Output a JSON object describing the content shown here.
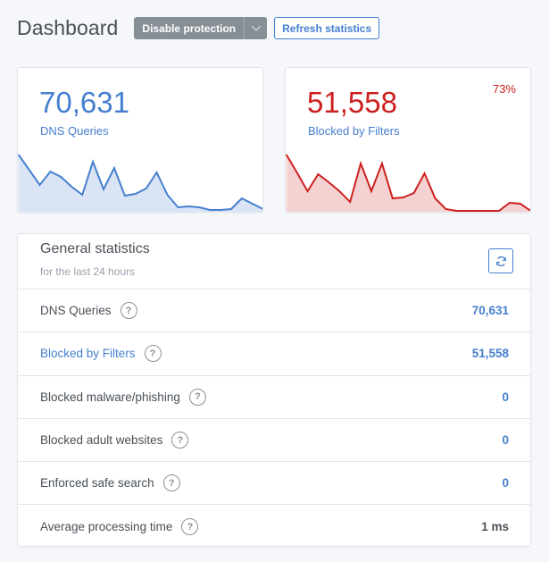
{
  "header": {
    "title": "Dashboard",
    "disable_button": "Disable protection",
    "refresh_button": "Refresh statistics"
  },
  "cards": {
    "queries": {
      "value": "70,631",
      "label": "DNS Queries",
      "color": "#467fcf",
      "fill": "#dae4f5"
    },
    "blocked": {
      "value": "51,558",
      "label": "Blocked by Filters",
      "percent": "73%",
      "color": "#cd201f",
      "fill": "#f5d2d2"
    }
  },
  "chart_data": [
    {
      "type": "area",
      "title": "DNS Queries",
      "x": [
        0,
        1,
        2,
        3,
        4,
        5,
        6,
        7,
        8,
        9,
        10,
        11,
        12,
        13,
        14,
        15,
        16,
        17,
        18,
        19,
        20,
        21,
        22,
        23
      ],
      "values": [
        64,
        47,
        30,
        45,
        39,
        28,
        19,
        56,
        25,
        49,
        18,
        20,
        26,
        44,
        19,
        5,
        6,
        5,
        2,
        2,
        3,
        15,
        9,
        3
      ]
    },
    {
      "type": "area",
      "title": "Blocked by Filters",
      "x": [
        0,
        1,
        2,
        3,
        4,
        5,
        6,
        7,
        8,
        9,
        10,
        11,
        12,
        13,
        14,
        15,
        16,
        17,
        18,
        19,
        20,
        21,
        22,
        23
      ],
      "values": [
        64,
        44,
        23,
        42,
        33,
        23,
        11,
        54,
        23,
        54,
        15,
        16,
        21,
        43,
        15,
        3,
        1,
        1,
        1,
        1,
        1,
        10,
        9,
        1
      ]
    }
  ],
  "general": {
    "title": "General statistics",
    "subtitle": "for the last 24 hours",
    "rows": [
      {
        "label": "DNS Queries",
        "value": "70,631"
      },
      {
        "label": "Blocked by Filters",
        "value": "51,558"
      },
      {
        "label": "Blocked malware/phishing",
        "value": "0"
      },
      {
        "label": "Blocked adult websites",
        "value": "0"
      },
      {
        "label": "Enforced safe search",
        "value": "0"
      },
      {
        "label": "Average processing time",
        "value": "1 ms"
      }
    ],
    "help_glyph": "?"
  }
}
